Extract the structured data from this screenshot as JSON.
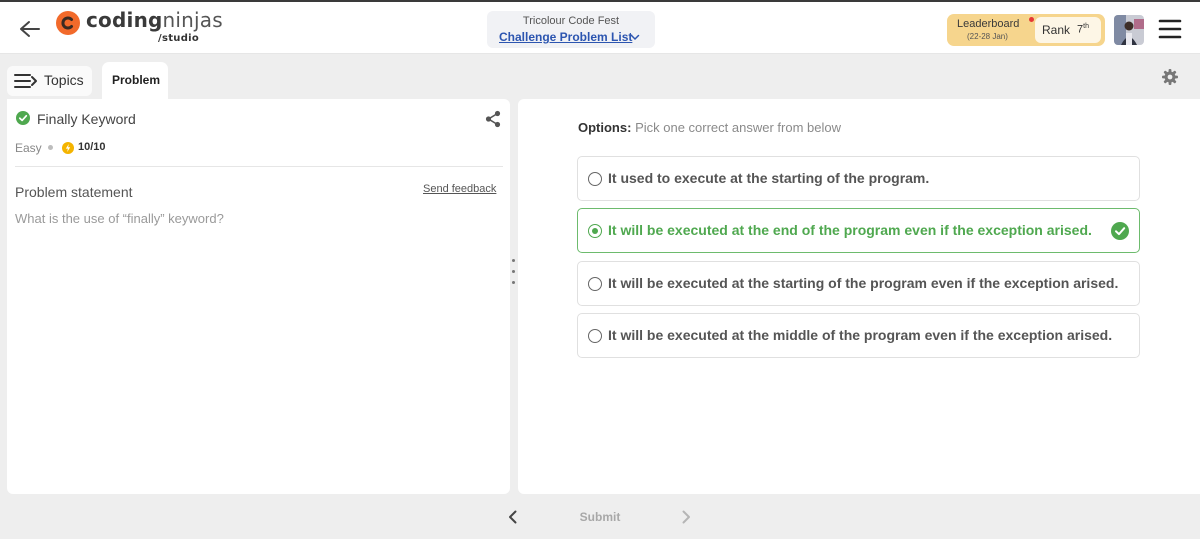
{
  "header": {
    "brand_bold": "coding",
    "brand_light": "ninjas",
    "brand_sub": "/studio",
    "event_title": "Tricolour Code Fest",
    "event_link": "Challenge Problem List",
    "leaderboard_title": "Leaderboard",
    "leaderboard_dates": "(22-28 Jan)",
    "rank_label": "Rank",
    "rank_value": "7",
    "rank_suffix": "th"
  },
  "tabs": {
    "topics": "Topics",
    "problem": "Problem"
  },
  "problem": {
    "title": "Finally Keyword",
    "difficulty": "Easy",
    "score": "10/10",
    "statement_heading": "Problem statement",
    "send_feedback": "Send feedback",
    "statement_text": "What is the use of “finally” keyword?"
  },
  "options_panel": {
    "heading_label": "Options:",
    "heading_sub": "Pick one correct answer from below",
    "options": [
      {
        "text": "It used to execute at the starting of the program.",
        "selected": false,
        "correct": false
      },
      {
        "text": "It will be executed at the end of the program even if the exception arised.",
        "selected": true,
        "correct": true
      },
      {
        "text": "It will be executed at the starting of the program even if the exception arised.",
        "selected": false,
        "correct": false
      },
      {
        "text": "It will be executed at the middle of the program even if the exception arised.",
        "selected": false,
        "correct": false
      }
    ]
  },
  "footer": {
    "submit_label": "Submit"
  },
  "colors": {
    "brand_orange": "#f26a2b",
    "correct_green": "#4fa84f",
    "link_blue": "#2c55b0",
    "leaderboard_bg": "#f6d58d"
  },
  "icons": [
    "back-arrow-icon",
    "logo-icon",
    "chevron-down-icon",
    "menu-icon",
    "topics-list-icon",
    "settings-gear-icon",
    "check-circle-icon",
    "share-icon",
    "bolt-icon",
    "chevron-left-icon",
    "chevron-right-icon"
  ]
}
